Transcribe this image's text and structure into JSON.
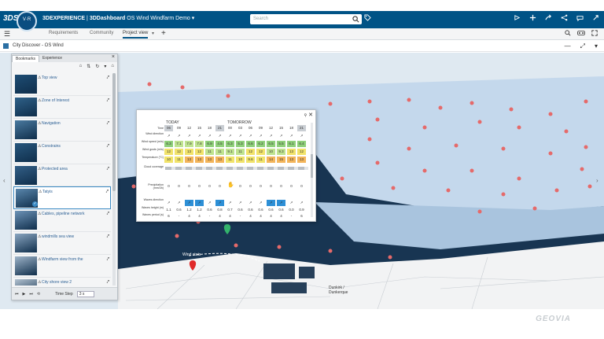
{
  "header": {
    "compass_text": "V·R",
    "brand_3dx": "3DEXPERIENCE",
    "brand_separator": "|",
    "brand_app": "3DDashboard",
    "dashboard_name": "OS Wind Windfarm Demo",
    "search_placeholder": "Search"
  },
  "tabs": {
    "items": [
      "Requirements",
      "Community",
      "Project view"
    ],
    "active": "Project view"
  },
  "widget": {
    "title": "City Discover - OS Wind"
  },
  "panel": {
    "tabs": [
      "Bookmarks",
      "Experience"
    ],
    "bookmarks": [
      {
        "label": "Top view",
        "selected": false
      },
      {
        "label": "Zone of Interest",
        "selected": false
      },
      {
        "label": "Navigation",
        "selected": false
      },
      {
        "label": "Constrains",
        "selected": false
      },
      {
        "label": "Protected area",
        "selected": false
      },
      {
        "label": "Tatyis",
        "selected": true
      },
      {
        "label": "Cables, pipeline network",
        "selected": false
      },
      {
        "label": "windmills sea view",
        "selected": false
      },
      {
        "label": "Windfarm view from the",
        "selected": false
      },
      {
        "label": "City shore view 2",
        "selected": false
      }
    ],
    "timestep_label": "Time Step",
    "timestep_value": "3 s"
  },
  "weather": {
    "day_today": "TODAY",
    "day_tomorrow": "TOMORROW",
    "time_label": "Time",
    "times": [
      "06",
      "09",
      "12",
      "15",
      "18",
      "21",
      "00",
      "03",
      "06",
      "09",
      "12",
      "15",
      "18",
      "21"
    ],
    "row_labels": {
      "wind_dir": "Wind direction",
      "wind_speed": "Wind speed (m/s)",
      "wind_gusts": "Wind gusts (m/s)",
      "temperature": "Temperature (°C)",
      "cloud": "Cloud coverage",
      "precip": "Precipitation (mm/3h)",
      "waves": "Waves direction",
      "wave_height": "Waves height (m)",
      "wave_period": "Waves period (s)"
    },
    "wind_speed": [
      "6.3",
      "7.1",
      "7.9",
      "7.8",
      "6.9",
      "4.5",
      "6.3",
      "5.3",
      "6.6",
      "6.2",
      "6.5",
      "5.5",
      "6.1",
      "6.4"
    ],
    "wind_gusts": [
      "12",
      "12",
      "13",
      "12",
      "11",
      "11",
      "9.1",
      "11",
      "12",
      "12",
      "10",
      "9.3",
      "13",
      "12"
    ],
    "temperature": [
      "10",
      "11",
      "13",
      "13",
      "13",
      "13",
      "11",
      "10",
      "9.6",
      "11",
      "14",
      "15",
      "13",
      "13"
    ],
    "precip": [
      "0",
      "0",
      "0",
      "0",
      "0",
      "0",
      "0",
      "0",
      "0",
      "0",
      "0",
      "0",
      "0",
      "0"
    ],
    "wave_height": [
      "1.1",
      "0.6",
      "1.2",
      "1.2",
      "0.6",
      "0.8",
      "0.7",
      "0.6",
      "0.6",
      "0.6",
      "0.6",
      "0.6",
      "0.0",
      "0.9"
    ],
    "wave_period": [
      "6",
      "-",
      "4",
      "4",
      "-",
      "4",
      "4",
      "-",
      "4",
      "4",
      "4",
      "4",
      "-",
      "6"
    ],
    "colors": {
      "green": "#8fd07a",
      "lightgreen": "#bfe38f",
      "yellow": "#f1e36a",
      "orange": "#f3b55a",
      "wave_blue": "#2d8fd6"
    }
  },
  "map": {
    "label_wind": "Wind stats",
    "label_city": "Dunkirk / Dunkerque",
    "sea_color": "#16304a",
    "offshore_color": "#c2d6ea"
  },
  "branding": {
    "geovia": "GEOVIA"
  }
}
